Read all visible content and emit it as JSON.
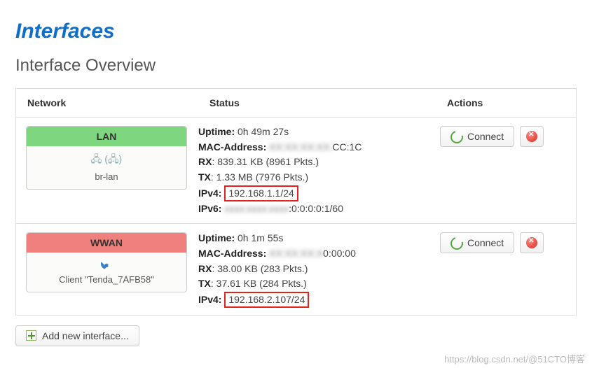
{
  "page": {
    "title": "Interfaces",
    "subtitle": "Interface Overview"
  },
  "headers": {
    "network": "Network",
    "status": "Status",
    "actions": "Actions"
  },
  "labels": {
    "uptime": "Uptime:",
    "mac": "MAC-Address:",
    "rx": "RX",
    "tx": "TX",
    "ipv4": "IPv4:",
    "ipv6": "IPv6:",
    "connect": "Connect",
    "add_iface": "Add new interface..."
  },
  "interfaces": [
    {
      "name": "LAN",
      "color": "green",
      "icon": "net",
      "device": "br-lan",
      "uptime": "0h 49m 27s",
      "mac_hidden": "XX:XX:XX:XX:",
      "mac_tail": "CC:1C",
      "rx": ": 839.31 KB (8961 Pkts.)",
      "tx": ": 1.33 MB (7976 Pkts.)",
      "ipv4": "192.168.1.1/24",
      "ipv6_hidden": "xxxx:xxxx:xxxx",
      "ipv6_tail": ":0:0:0:0:1/60"
    },
    {
      "name": "WWAN",
      "color": "red",
      "icon": "wifi",
      "device": "Client \"Tenda_7AFB58\"",
      "uptime": "0h 1m 55s",
      "mac_hidden": "XX:XX:XX:X",
      "mac_tail": "0:00:00",
      "rx": ": 38.00 KB (283 Pkts.)",
      "tx": ": 37.61 KB (284 Pkts.)",
      "ipv4": "192.168.2.107/24"
    }
  ],
  "watermark": "https://blog.csdn.net/@51CTO博客"
}
